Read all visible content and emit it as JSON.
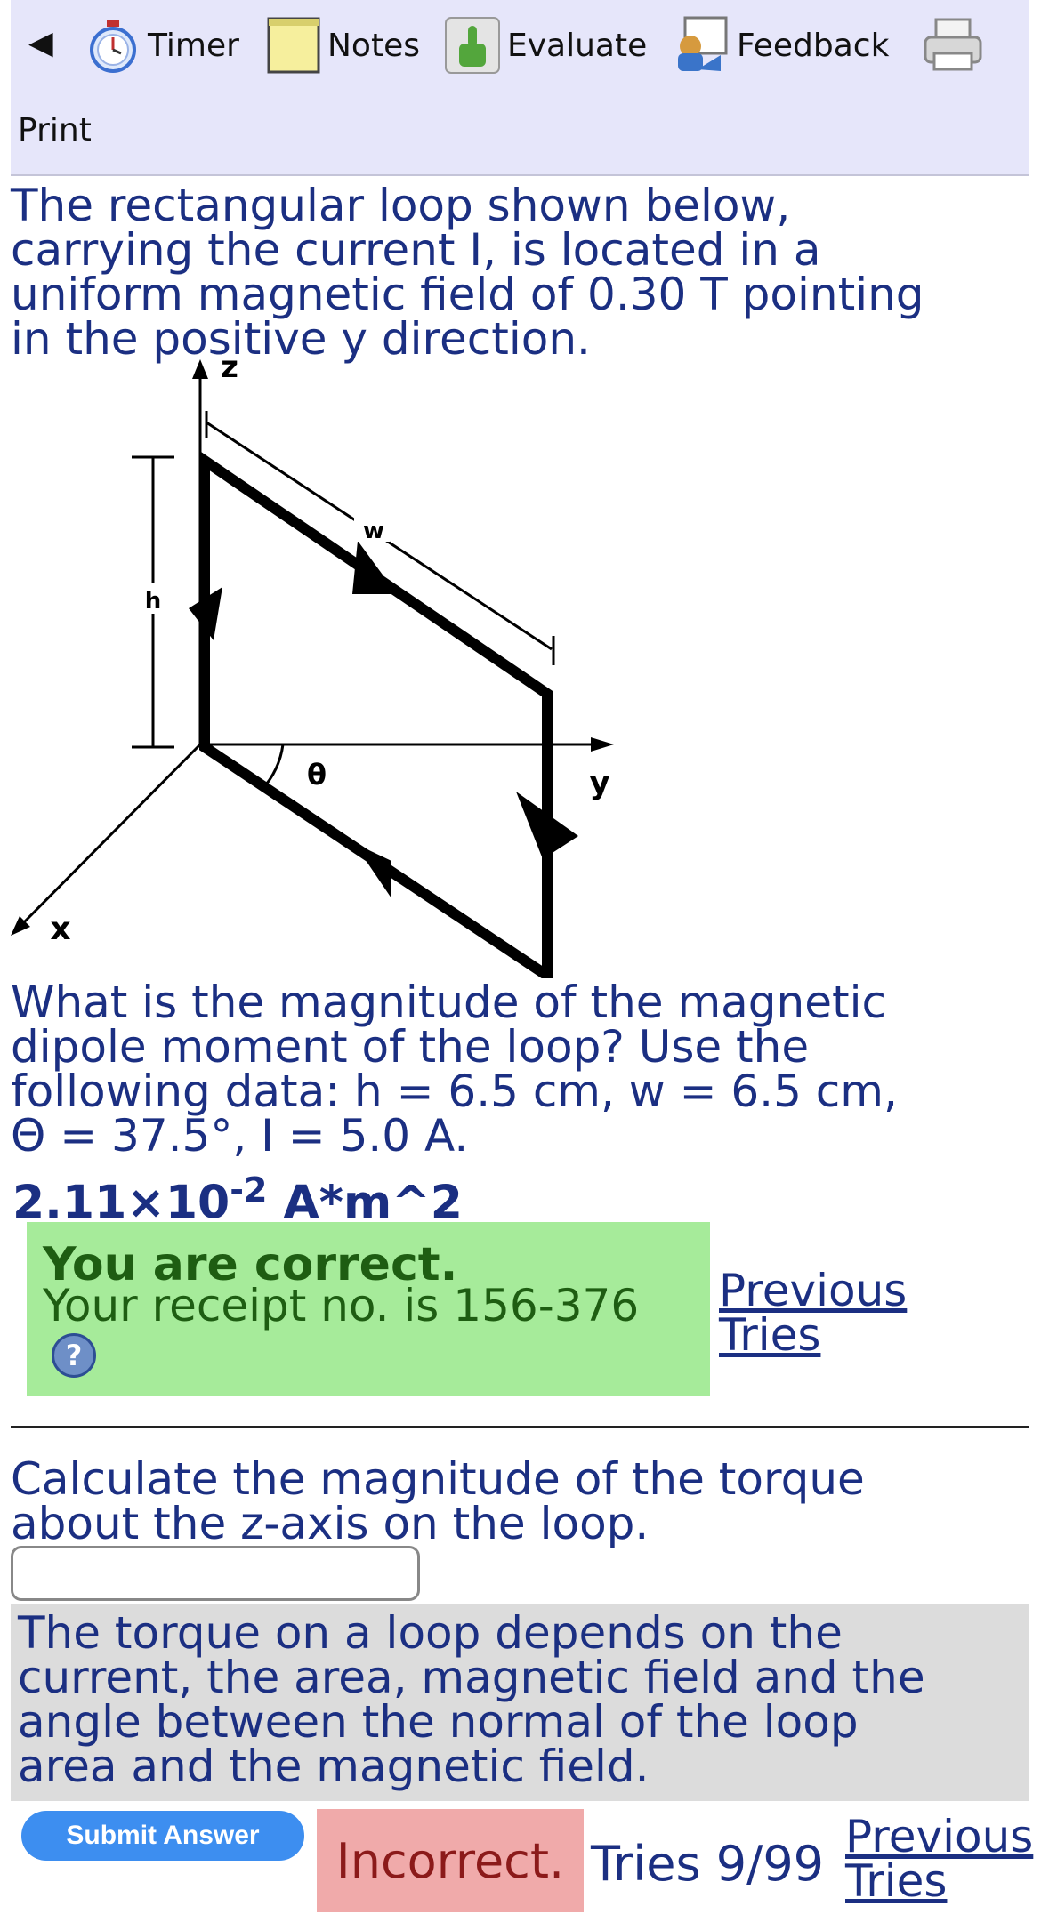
{
  "toolbar": {
    "back_icon": "back-arrow-icon",
    "timer_label": "Timer",
    "notes_label": "Notes",
    "evaluate_label": "Evaluate",
    "feedback_label": "Feedback",
    "print_label": "Print"
  },
  "question1": {
    "intro_lines": [
      "The rectangular loop shown below,",
      "carrying the current I, is located in a",
      "uniform magnetic field of 0.30 T pointing",
      "in the positive y direction."
    ],
    "diagram_labels": {
      "z": "z",
      "y": "y",
      "x": "x",
      "w": "w",
      "h": "h",
      "theta": "θ"
    },
    "question_lines": [
      "What is the magnitude of the magnetic",
      "dipole moment of the loop? Use the",
      "following data: h = 6.5 cm, w = 6.5 cm,",
      "Θ = 37.5°, I = 5.0 A."
    ],
    "answer_mantissa": "2.11×10",
    "answer_exponent": "-2",
    "answer_unit": " A*m^2",
    "result_title": "You are correct.",
    "receipt": "Your receipt no. is 156-376",
    "previous_tries_line1": "Previous",
    "previous_tries_line2": "Tries"
  },
  "question2": {
    "prompt_lines": [
      "Calculate the magnitude of the torque",
      "about the z-axis on the loop."
    ],
    "answer_value": "",
    "hint_lines": [
      "The torque on a loop depends on the",
      "current, the area, magnetic field and the",
      "angle between the normal of the loop",
      "area and the magnetic field."
    ],
    "submit_label": "Submit Answer",
    "status": "Incorrect.",
    "tries": "Tries 9/99",
    "previous_tries_line1": "Previous",
    "previous_tries_line2": "Tries"
  },
  "colors": {
    "toolbar_bg": "#e6e6fa",
    "text_blue": "#1b2f82",
    "correct_bg": "#a6eb9a",
    "hint_bg": "#dcdcdc",
    "incorrect_bg": "#f0aaaa",
    "submit_bg": "#3d8ef0"
  }
}
